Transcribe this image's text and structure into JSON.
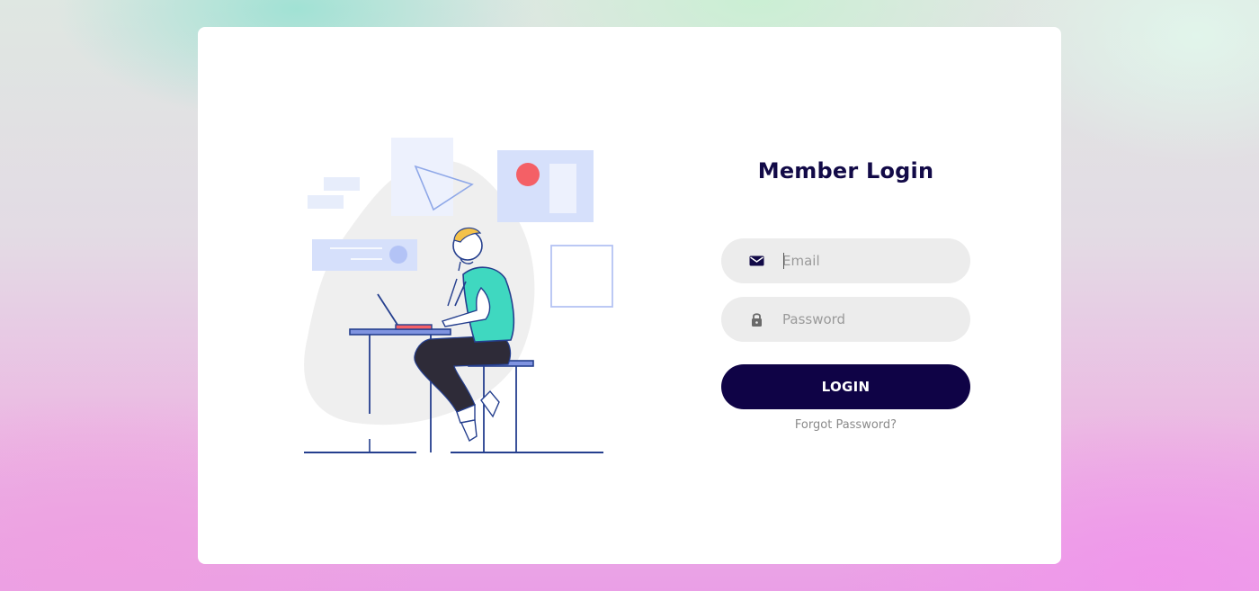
{
  "login": {
    "title": "Member Login",
    "email": {
      "placeholder": "Email",
      "value": "",
      "icon": "envelope-icon"
    },
    "password": {
      "placeholder": "Password",
      "value": "",
      "icon": "lock-icon"
    },
    "submit_label": "LOGIN",
    "forgot_label": "Forgot Password?"
  },
  "illustration": {
    "subject": "person-working-on-laptop"
  },
  "colors": {
    "accent": "#0f0346",
    "title": "#120a47",
    "field_bg": "#ececec",
    "illustration_blue": "#253f8e",
    "shirt": "#3fd8c0",
    "red_dot": "#f46066"
  }
}
